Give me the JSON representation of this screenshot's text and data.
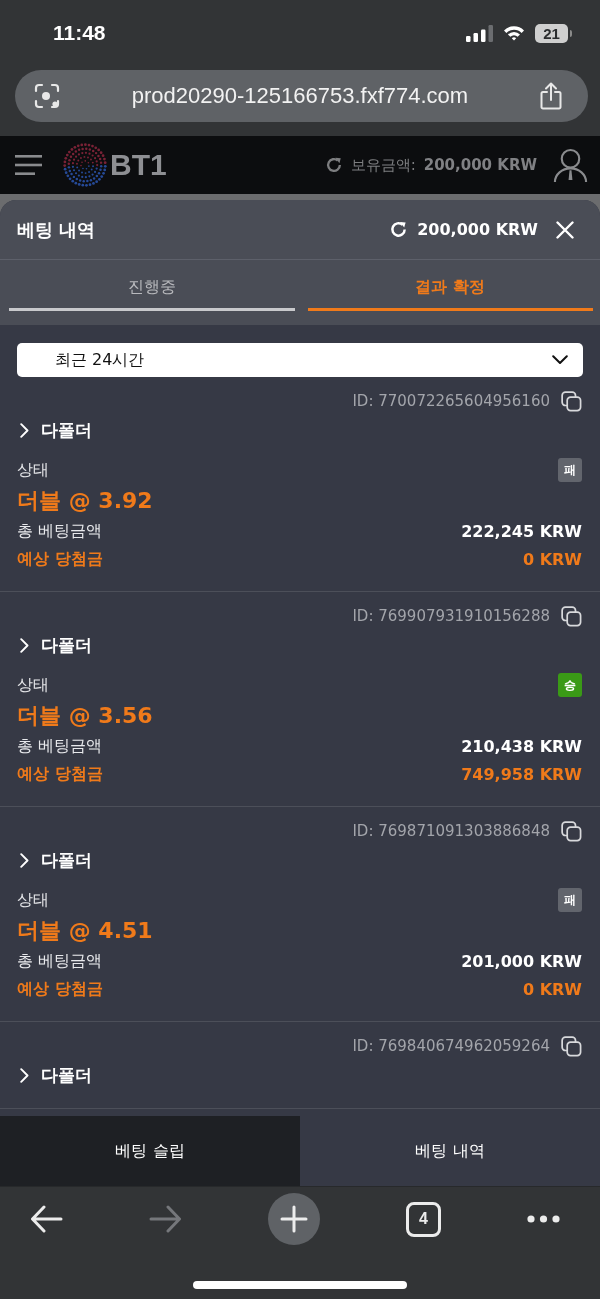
{
  "status_bar": {
    "time": "11:48",
    "battery": "21"
  },
  "browser": {
    "url": "prod20290-125166753.fxf774.com"
  },
  "site_header": {
    "logo": "BT1",
    "balance_label": "보유금액:",
    "balance": "200,000 KRW"
  },
  "panel": {
    "title": "베팅 내역",
    "balance": "200,000 KRW"
  },
  "tabs": [
    {
      "label": "진행중",
      "selected": false
    },
    {
      "label": "결과 확정",
      "selected": true
    }
  ],
  "filter": {
    "value": "최근 24시간"
  },
  "bets": [
    {
      "id": "ID: 770072265604956160",
      "type": "다폴더",
      "status_label": "상태",
      "result": {
        "label": "패",
        "color": "#62656d"
      },
      "odds": "더블 @ 3.92",
      "stake_label": "총 베팅금액",
      "stake": "222,245 KRW",
      "payout_label": "예상 당첨금",
      "payout": "0 KRW"
    },
    {
      "id": "ID: 769907931910156288",
      "type": "다폴더",
      "status_label": "상태",
      "result": {
        "label": "승",
        "color": "#3a9a16"
      },
      "odds": "더블 @ 3.56",
      "stake_label": "총 베팅금액",
      "stake": "210,438 KRW",
      "payout_label": "예상 당첨금",
      "payout": "749,958 KRW"
    },
    {
      "id": "ID: 769871091303886848",
      "type": "다폴더",
      "status_label": "상태",
      "result": {
        "label": "패",
        "color": "#62656d"
      },
      "odds": "더블 @ 4.51",
      "stake_label": "총 베팅금액",
      "stake": "201,000 KRW",
      "payout_label": "예상 당첨금",
      "payout": "0 KRW"
    },
    {
      "id": "ID: 769840674962059264",
      "type": "다폴더"
    }
  ],
  "bottom_tabs": [
    {
      "label": "베팅 슬립",
      "selected": false
    },
    {
      "label": "베팅 내역",
      "selected": true
    }
  ],
  "browser_toolbar": {
    "forward_disabled": true,
    "tab_count": "4"
  }
}
